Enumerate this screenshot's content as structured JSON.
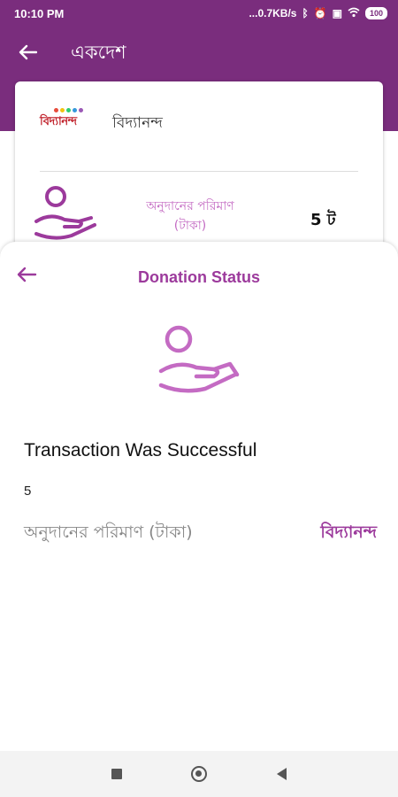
{
  "status_bar": {
    "time": "10:10 PM",
    "network_speed": "...0.7KB/s",
    "icons": [
      "bluetooth-icon",
      "alarm-icon",
      "sim-icon",
      "wifi-icon"
    ],
    "battery": "100"
  },
  "header": {
    "title": "একদেশ",
    "back_icon": "arrow-left-icon"
  },
  "card": {
    "org_name": "বিদ্যানন্দ",
    "logo_text": "বিদ্যানন্দ",
    "amount_label": "অনুদানের পরিমাণ (টাকা)",
    "amount_value": "5 ট"
  },
  "sheet": {
    "title": "Donation Status",
    "status_text": "Transaction Was Successful",
    "amount": "5",
    "amount_label": "অনুদানের পরিমাণ (টাকা)",
    "org_name": "বিদ্যানন্দ"
  },
  "colors": {
    "primary": "#7a2d7d",
    "accent": "#9c3a9c",
    "icon_light": "#c46bc3"
  },
  "nav_bar": {
    "icons": [
      "recent-apps-icon",
      "home-icon",
      "back-triangle-icon"
    ]
  }
}
